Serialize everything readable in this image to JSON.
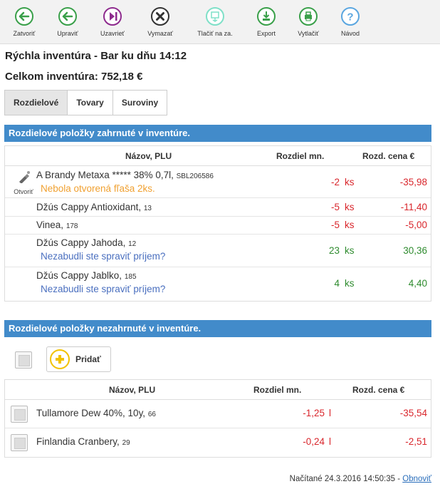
{
  "toolbar": {
    "buttons": [
      {
        "label": "Zatvoriť",
        "icon": "arrow-left-icon"
      },
      {
        "label": "Upraviť",
        "icon": "arrow-left-icon"
      },
      {
        "label": "Uzavrieť",
        "icon": "play-end-icon"
      },
      {
        "label": "Vymazať",
        "icon": "close-icon"
      },
      {
        "label": "Tlačiť na za.",
        "icon": "print-device-icon"
      },
      {
        "label": "Export",
        "icon": "export-icon"
      },
      {
        "label": "Vytlačiť",
        "icon": "printer-icon"
      },
      {
        "label": "Návod",
        "icon": "help-icon"
      }
    ]
  },
  "header": {
    "title": "Rýchla inventúra - Bar ku dňu 14:12",
    "total": "Celkom inventúra: 752,18 €"
  },
  "tabs": [
    "Rozdielové",
    "Tovary",
    "Suroviny"
  ],
  "section1": {
    "title": "Rozdielové položky zahrnuté v inventúre.",
    "columns": {
      "name": "Názov, PLU",
      "diff": "Rozdiel mn.",
      "price": "Rozd. cena €"
    },
    "open_label": "Otvoriť",
    "rows": [
      {
        "name": "A Brandy Metaxa ***** 38% 0,7l,",
        "plu": "SBL206586",
        "note": "Nebola otvorená fľaša 2ks.",
        "diff": "-2",
        "unit": "ks",
        "price": "-35,98"
      },
      {
        "name": "Džús Cappy Antioxidant,",
        "plu": "13",
        "note": "",
        "diff": "-5",
        "unit": "ks",
        "price": "-11,40"
      },
      {
        "name": "Vinea,",
        "plu": "178",
        "note": "",
        "diff": "-5",
        "unit": "ks",
        "price": "-5,00"
      },
      {
        "name": "Džús Cappy Jahoda,",
        "plu": "12",
        "note": "Nezabudli ste spraviť príjem?",
        "diff": "23",
        "unit": "ks",
        "price": "30,36"
      },
      {
        "name": "Džús Cappy Jablko,",
        "plu": "185",
        "note": "Nezabudli ste spraviť príjem?",
        "diff": "4",
        "unit": "ks",
        "price": "4,40"
      }
    ]
  },
  "section2": {
    "title": "Rozdielové položky nezahrnuté v inventúre.",
    "add_label": "Pridať",
    "columns": {
      "name": "Názov, PLU",
      "diff": "Rozdiel mn.",
      "price": "Rozd. cena €"
    },
    "rows": [
      {
        "name": "Tullamore Dew 40%, 10y,",
        "plu": "66",
        "diff": "-1,25",
        "unit": "l",
        "price": "-35,54"
      },
      {
        "name": "Finlandia Cranbery,",
        "plu": "29",
        "diff": "-0,24",
        "unit": "l",
        "price": "-2,51"
      }
    ]
  },
  "footer": {
    "loaded": "Načítané 24.3.2016 14:50:35 -",
    "refresh": "Obnoviť"
  }
}
